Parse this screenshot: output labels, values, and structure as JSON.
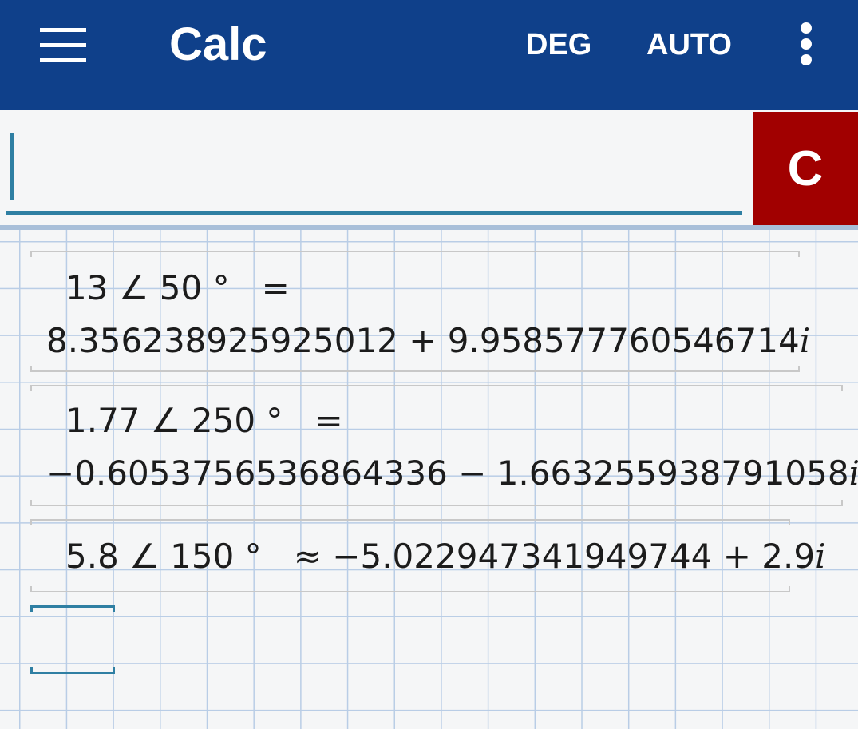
{
  "appbar": {
    "title": "Calc",
    "angle_mode": "DEG",
    "format_mode": "AUTO",
    "menu_icon": "hamburger-menu-icon",
    "more_icon": "more-vertical-icon"
  },
  "input": {
    "value": "",
    "clear_label": "C"
  },
  "history": [
    {
      "expression": "13 ∠ 50 °",
      "relation": "=",
      "result_real": "8.356238925925012 + 9.958577760546714",
      "imag_unit": "i"
    },
    {
      "expression": "1.77 ∠ 250 °",
      "relation": "=",
      "result_real": "−0.6053756536864336 − 1.663255938791058",
      "imag_unit": "i"
    },
    {
      "expression": "5.8 ∠ 150 °",
      "relation": "≈",
      "result_real": "−5.022947341949744 + 2.9",
      "imag_unit": "i"
    }
  ],
  "colors": {
    "appbar": "#0f408a",
    "clear_button": "#a10000",
    "accent": "#2f7fa3",
    "grid_line": "#b9cde6"
  }
}
